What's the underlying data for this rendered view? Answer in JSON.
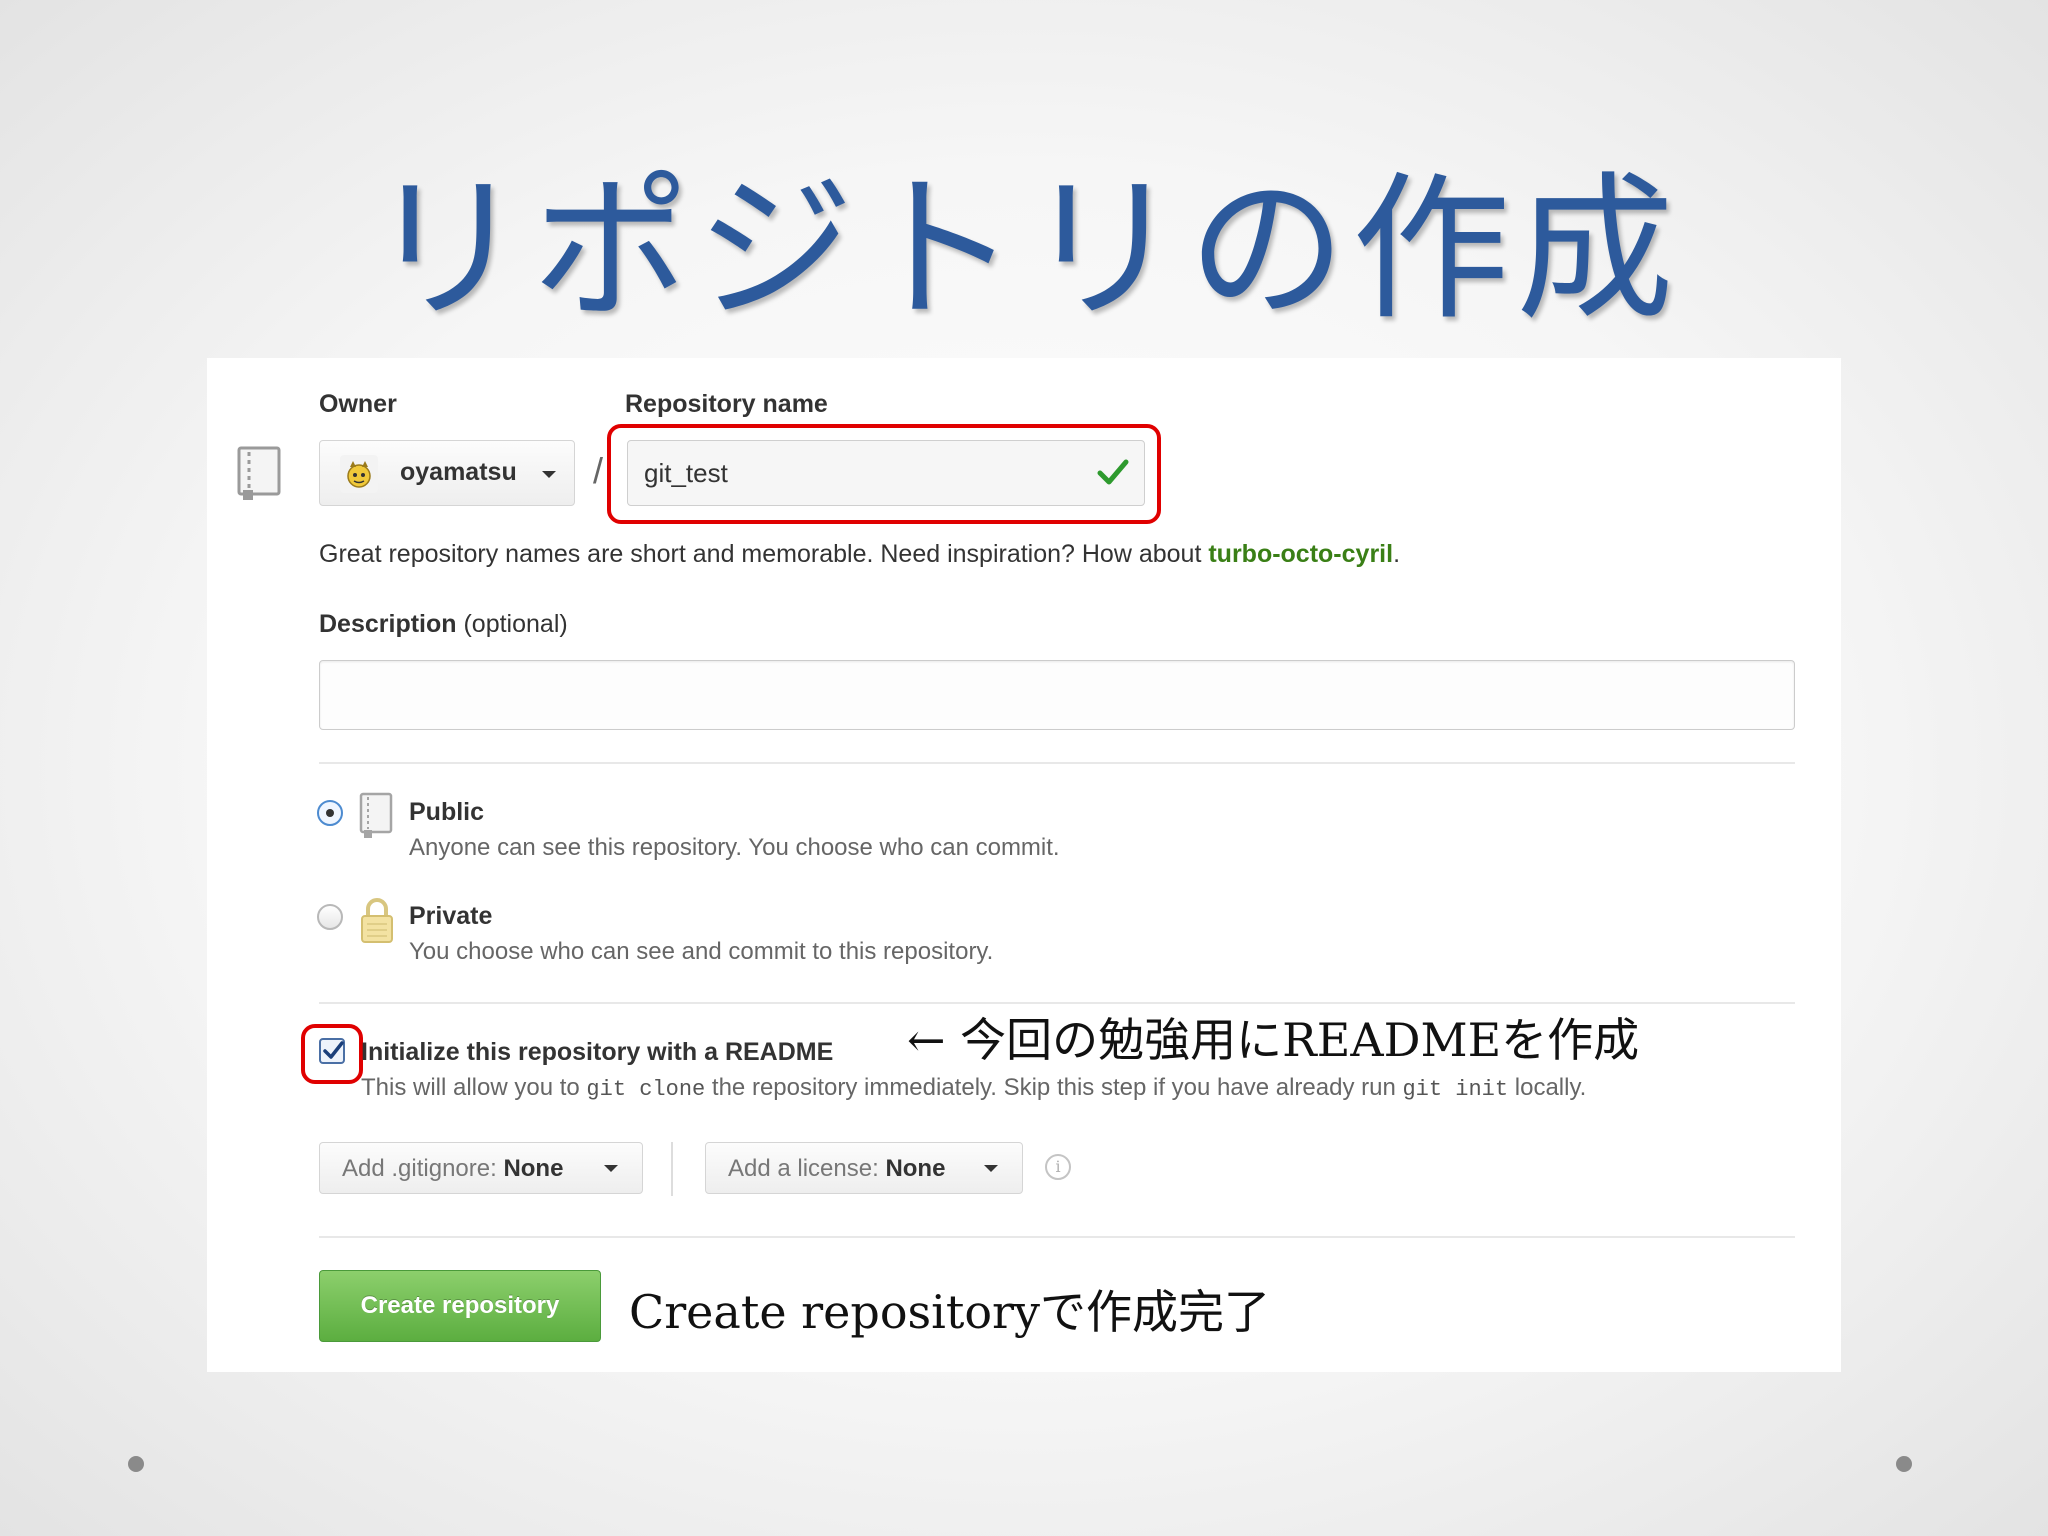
{
  "slide": {
    "title": "リポジトリの作成"
  },
  "form": {
    "owner_label": "Owner",
    "owner_value": "oyamatsu",
    "repo_label": "Repository name",
    "repo_value": "git_test",
    "slash": "/",
    "hint_text": "Great repository names are short and memorable. Need inspiration? How about ",
    "hint_suggestion": "turbo-octo-cyril",
    "hint_end": ".",
    "description_label": "Description",
    "description_optional": " (optional)",
    "description_value": "",
    "public_title": "Public",
    "public_desc": "Anyone can see this repository. You choose who can commit.",
    "private_title": "Private",
    "private_desc": "You choose who can see and commit to this repository.",
    "readme_label": "Initialize this repository with a README",
    "readme_desc_1": "This will allow you to ",
    "readme_code_1": "git clone",
    "readme_desc_2": " the repository immediately. Skip this step if you have already run ",
    "readme_code_2": "git init",
    "readme_desc_3": " locally.",
    "gitignore_prefix": "Add .gitignore: ",
    "gitignore_value": "None",
    "license_prefix": "Add a license: ",
    "license_value": "None",
    "info_glyph": "i",
    "create_button": "Create repository"
  },
  "annotations": {
    "readme_note": "← 今回の勉強用にREADMEを作成",
    "create_note": "Create repositoryで作成完了"
  },
  "state": {
    "visibility": "public",
    "initialize_readme": true,
    "repo_name_valid": true
  },
  "colors": {
    "title": "#2d5a9c",
    "highlight_box": "#e00000",
    "suggestion_link": "#3a7f16",
    "create_button": "#6dbd4e",
    "check_mark": "#2e9a2e"
  },
  "icons": {
    "repo": "repo-book-icon",
    "owner_avatar": "octocat-avatar-icon",
    "valid": "checkmark-icon",
    "public": "public-repo-icon",
    "private": "padlock-icon",
    "info": "info-icon"
  }
}
